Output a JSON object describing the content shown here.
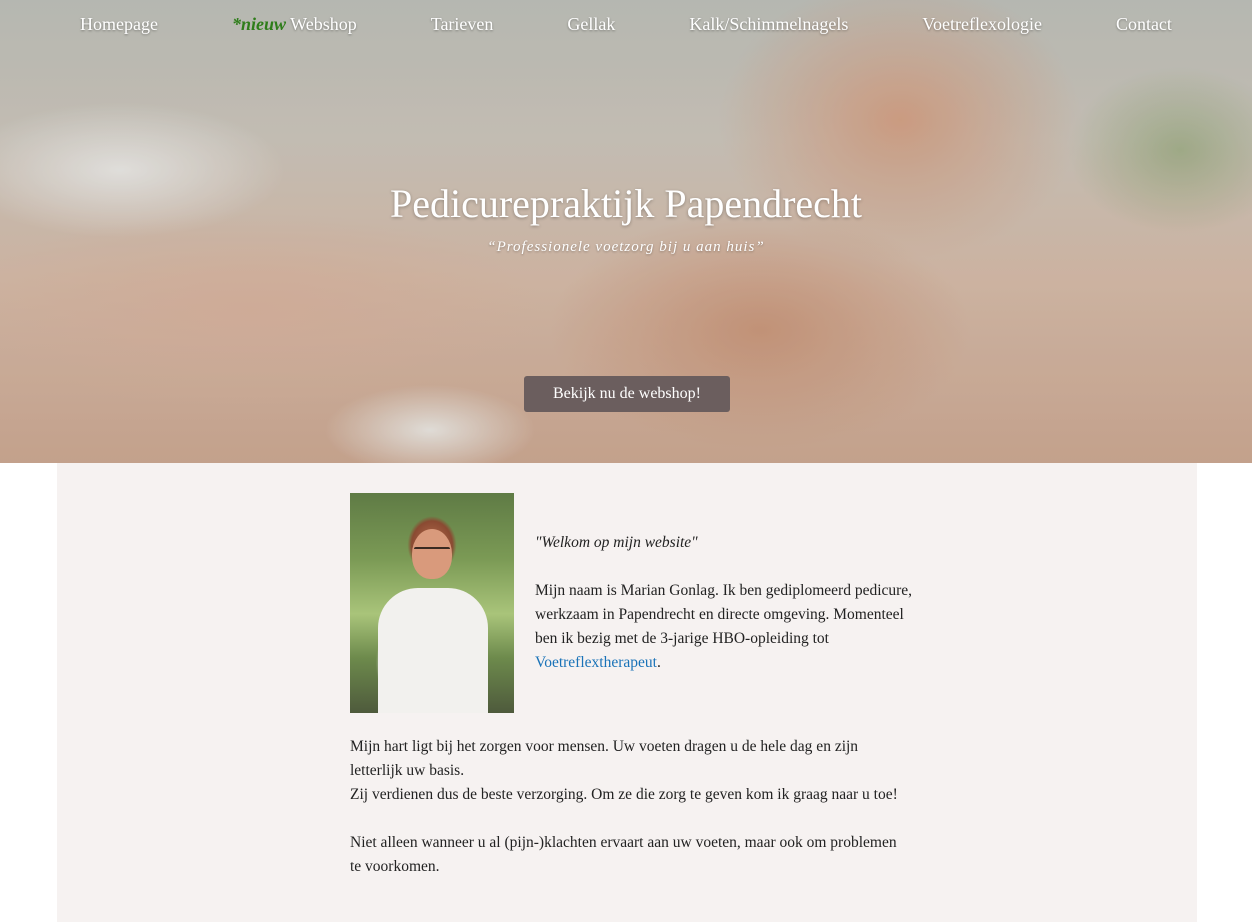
{
  "nav": {
    "items": [
      {
        "label": "Homepage"
      },
      {
        "tag": "*nieuw",
        "label": "Webshop"
      },
      {
        "label": "Tarieven"
      },
      {
        "label": "Gellak"
      },
      {
        "label": "Kalk/Schimmelnagels"
      },
      {
        "label": "Voetreflexologie"
      },
      {
        "label": "Contact"
      }
    ]
  },
  "hero": {
    "title": "Pedicurepraktijk Papendrecht",
    "subtitle": "“Professionele voetzorg bij u aan huis”",
    "cta_label": "Bekijk nu de webshop!"
  },
  "intro": {
    "welcome": "\"Welkom op mijn website\"",
    "text_before_link": "Mijn naam is Marian Gonlag. Ik ben gediplomeerd pedicure, werkzaam in Papendrecht en directe omgeving. Momenteel ben ik bezig met de 3-jarige HBO-opleiding tot ",
    "link_text": "Voetreflextherapeut",
    "text_after_link": "."
  },
  "body": {
    "p1_line1": "Mijn hart ligt bij het zorgen voor mensen. Uw voeten dragen u de hele dag en zijn letterlijk uw basis.",
    "p1_line2": "Zij verdienen dus de beste verzorging. Om ze die zorg te geven kom ik graag naar u toe!",
    "p2": "Niet alleen wanneer u al (pijn-)klachten ervaart aan uw voeten, maar ook om problemen te voorkomen."
  },
  "colors": {
    "cta_bg": "#6b5e5e",
    "content_bg": "#f6f2f1",
    "link": "#1a73b8",
    "new_tag": "#2e7d1a"
  }
}
